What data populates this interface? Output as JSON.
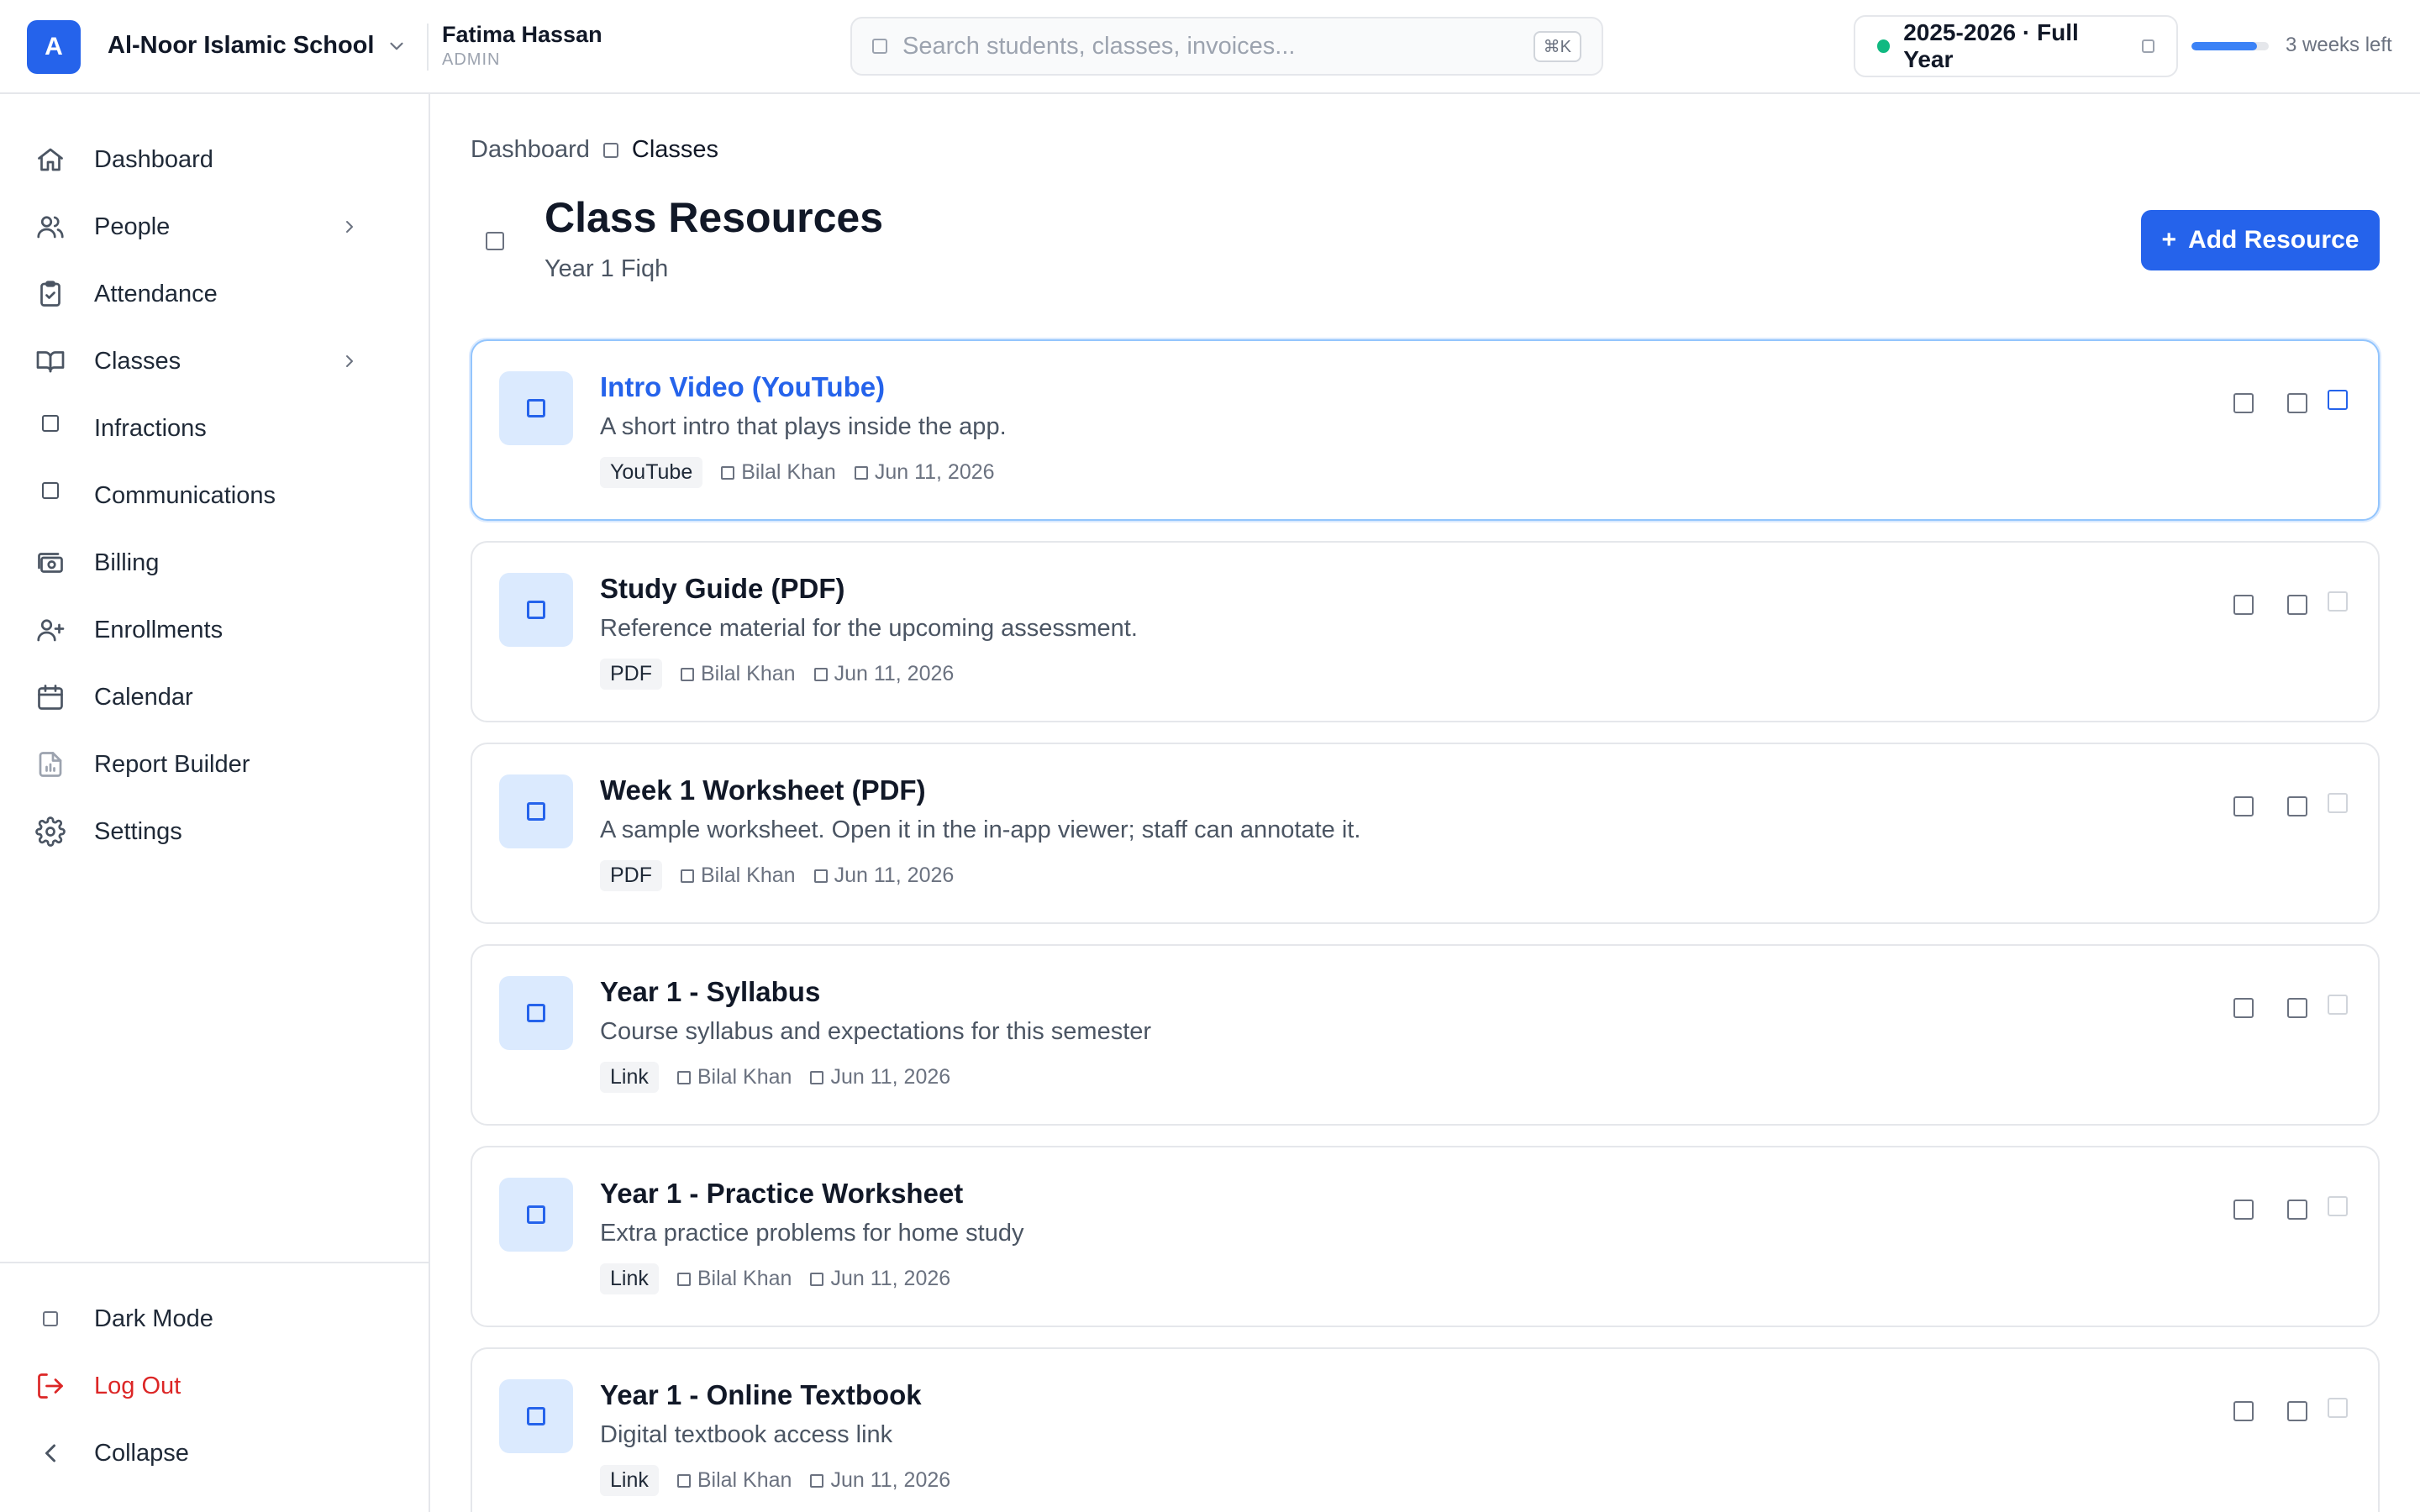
{
  "header": {
    "logo_letter": "A",
    "school_name": "Al-Noor Islamic School",
    "user_name": "Fatima Hassan",
    "user_role": "ADMIN",
    "search_placeholder": "Search students, classes, invoices...",
    "search_shortcut": "⌘K",
    "academic_year": "2025-2026 · Full Year",
    "term_progress_percent": 85,
    "weeks_left": "3 weeks left"
  },
  "sidebar": {
    "items": [
      {
        "label": "Dashboard",
        "icon": "home-icon"
      },
      {
        "label": "People",
        "icon": "users-icon",
        "expandable": true
      },
      {
        "label": "Attendance",
        "icon": "clipboard-check-icon"
      },
      {
        "label": "Classes",
        "icon": "book-icon",
        "expandable": true
      },
      {
        "label": "Infractions",
        "icon": "square-icon"
      },
      {
        "label": "Communications",
        "icon": "square-icon"
      },
      {
        "label": "Billing",
        "icon": "banknotes-icon"
      },
      {
        "label": "Enrollments",
        "icon": "user-plus-icon"
      },
      {
        "label": "Calendar",
        "icon": "calendar-icon"
      },
      {
        "label": "Report Builder",
        "icon": "report-icon"
      },
      {
        "label": "Settings",
        "icon": "gear-icon"
      }
    ],
    "footer": {
      "dark_mode": "Dark Mode",
      "log_out": "Log Out",
      "collapse": "Collapse"
    }
  },
  "breadcrumb": {
    "parent": "Dashboard",
    "current": "Classes"
  },
  "page": {
    "title": "Class Resources",
    "subtitle": "Year 1 Fiqh",
    "add_button": "Add Resource"
  },
  "resources": [
    {
      "title": "Intro Video (YouTube)",
      "description": "A short intro that plays inside the app.",
      "type": "YouTube",
      "author": "Bilal Khan",
      "date": "Jun 11, 2026"
    },
    {
      "title": "Study Guide (PDF)",
      "description": "Reference material for the upcoming assessment.",
      "type": "PDF",
      "author": "Bilal Khan",
      "date": "Jun 11, 2026"
    },
    {
      "title": "Week 1 Worksheet (PDF)",
      "description": "A sample worksheet. Open it in the in-app viewer; staff can annotate it.",
      "type": "PDF",
      "author": "Bilal Khan",
      "date": "Jun 11, 2026"
    },
    {
      "title": "Year 1 - Syllabus",
      "description": "Course syllabus and expectations for this semester",
      "type": "Link",
      "author": "Bilal Khan",
      "date": "Jun 11, 2026"
    },
    {
      "title": "Year 1 - Practice Worksheet",
      "description": "Extra practice problems for home study",
      "type": "Link",
      "author": "Bilal Khan",
      "date": "Jun 11, 2026"
    },
    {
      "title": "Year 1 - Online Textbook",
      "description": "Digital textbook access link",
      "type": "Link",
      "author": "Bilal Khan",
      "date": "Jun 11, 2026"
    }
  ],
  "colors": {
    "accent": "#2563eb",
    "accent_light": "#dbeafe",
    "status_dot": "#10b981",
    "danger": "#dc2626"
  }
}
